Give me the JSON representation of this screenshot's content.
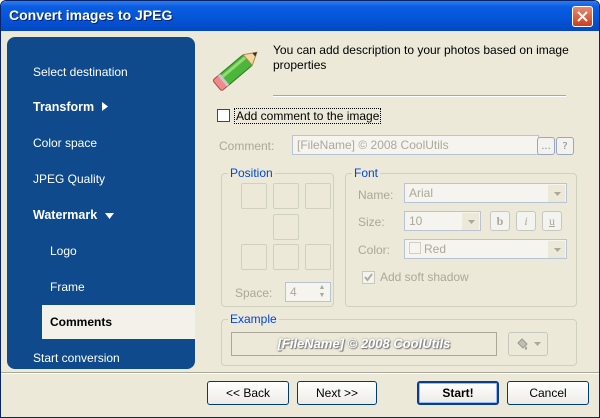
{
  "window": {
    "title": "Convert images to JPEG"
  },
  "sidebar": {
    "items": [
      {
        "label": "Select destination"
      },
      {
        "label": "Transform"
      },
      {
        "label": "Color space"
      },
      {
        "label": "JPEG Quality"
      },
      {
        "label": "Watermark"
      },
      {
        "label": "Logo"
      },
      {
        "label": "Frame"
      },
      {
        "label": "Comments"
      },
      {
        "label": "Start conversion"
      }
    ]
  },
  "header": {
    "description": "You can add description to your photos based on image properties"
  },
  "comment": {
    "checkbox_label": "Add comment to the image",
    "field_label": "Comment:",
    "value": "[FileName] © 2008 CoolUtils",
    "btn_dots": "...",
    "btn_question": "?"
  },
  "position": {
    "group_label": "Position",
    "space_label": "Space:",
    "space_value": "4"
  },
  "font": {
    "group_label": "Font",
    "name_label": "Name:",
    "name_value": "Arial",
    "size_label": "Size:",
    "size_value": "10",
    "bold": "b",
    "italic": "i",
    "underline": "u",
    "color_label": "Color:",
    "color_value": "Red",
    "shadow_label": "Add soft shadow"
  },
  "example": {
    "group_label": "Example",
    "text": "[FileName] © 2008 CoolUtils"
  },
  "buttons": {
    "back": "<< Back",
    "next": "Next >>",
    "start": "Start!",
    "cancel": "Cancel"
  }
}
